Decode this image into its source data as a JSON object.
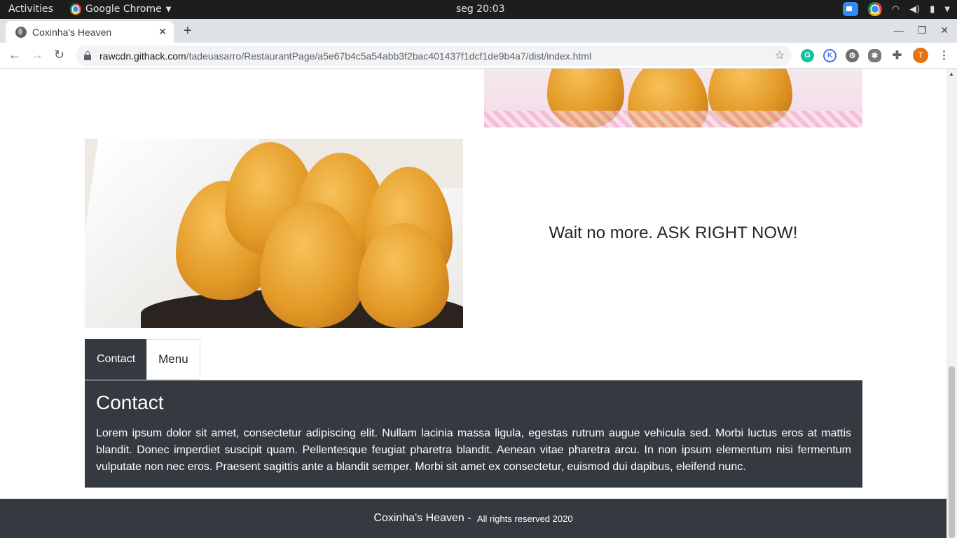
{
  "system_bar": {
    "activities": "Activities",
    "app_name": "Google Chrome",
    "clock": "seg 20:03"
  },
  "browser": {
    "tab_title": "Coxinha's Heaven",
    "url_host": "rawcdn.githack.com",
    "url_path": "/tadeuasarro/RestaurantPage/a5e67b4c5a54abb3f2bac401437f1dcf1de9b4a7/dist/index.html",
    "avatar_initial": "T"
  },
  "page": {
    "cta_text": "Wait no more. ASK RIGHT NOW!",
    "tabs": [
      {
        "label": "Contact",
        "active": true
      },
      {
        "label": "Menu",
        "active": false
      }
    ],
    "contact": {
      "heading": "Contact",
      "body": "Lorem ipsum dolor sit amet, consectetur adipiscing elit. Nullam lacinia massa ligula, egestas rutrum augue vehicula sed. Morbi luctus eros at mattis blandit. Donec imperdiet suscipit quam. Pellentesque feugiat pharetra blandit. Aenean vitae pharetra arcu. In non ipsum elementum nisi fermentum vulputate non nec eros. Praesent sagittis ante a blandit semper. Morbi sit amet ex consectetur, euismod dui dapibus, eleifend nunc."
    },
    "footer": {
      "brand": "Coxinha's Heaven",
      "separator": " - ",
      "rights": "All rights reserved 2020"
    }
  },
  "colors": {
    "dark_panel": "#343a40",
    "top_bar": "#1d1d1d",
    "tab_strip": "#dee1e6"
  }
}
